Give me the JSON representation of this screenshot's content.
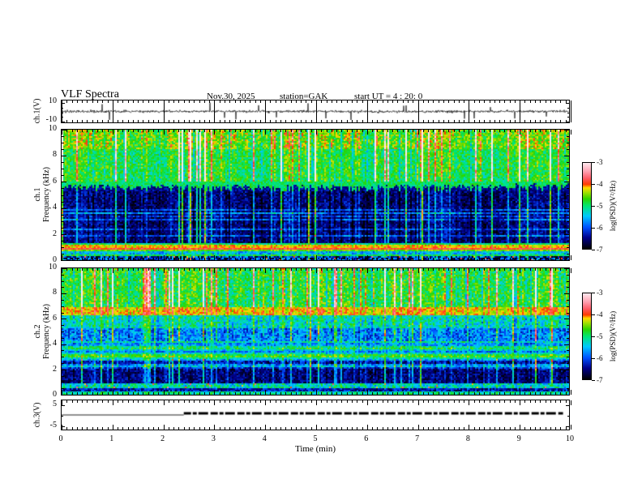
{
  "header": {
    "title": "VLF Spectra",
    "date": "Nov.30, 2025",
    "station": "station=GAK",
    "start_ut": "start UT =  4 : 20: 0"
  },
  "axes": {
    "x": {
      "label": "Time  (min)",
      "min": 0,
      "max": 10,
      "ticks": [
        "0",
        "1",
        "2",
        "3",
        "4",
        "5",
        "6",
        "7",
        "8",
        "9",
        "10"
      ],
      "minor_step_min": 0.1
    },
    "freq_ticks": [
      "10",
      "8",
      "6",
      "4",
      "2",
      "0"
    ],
    "wave_ticks": [
      "10",
      "-10"
    ],
    "ch3_ticks": [
      "5",
      "-5"
    ]
  },
  "panels": {
    "ch1_wave": {
      "ylabel": "ch.1(V)"
    },
    "ch1_spec": {
      "ylabel_line1": "ch.1",
      "ylabel_line2": "Frequency  (kHz)"
    },
    "ch2_spec": {
      "ylabel_line1": "ch.2",
      "ylabel_line2": "Frequency  (kHz)"
    },
    "ch3": {
      "ylabel": "ch.3(V)"
    }
  },
  "colorbar": {
    "label": "log(PSD)(V²/Hz)",
    "tick_labels": [
      "-3",
      "-4",
      "-5",
      "-6",
      "-7"
    ],
    "min": -7,
    "max": -3,
    "stops": [
      [
        0,
        "#000000"
      ],
      [
        0.13,
        "#00008c"
      ],
      [
        0.25,
        "#0050ff"
      ],
      [
        0.38,
        "#00c8ff"
      ],
      [
        0.5,
        "#00e673"
      ],
      [
        0.58,
        "#2bd500"
      ],
      [
        0.66,
        "#aae000"
      ],
      [
        0.71,
        "#ffd800"
      ],
      [
        0.75,
        "#ff3c00"
      ],
      [
        0.82,
        "#ff5a66"
      ],
      [
        0.9,
        "#ff9fb0"
      ],
      [
        1,
        "#ffe9ef"
      ]
    ]
  },
  "chart_data": [
    {
      "type": "line",
      "name": "ch.1 voltage waveform",
      "ylabel": "ch.1(V)",
      "xlim": [
        0,
        10
      ],
      "ylim": [
        -10,
        10
      ],
      "baseline_V": 0,
      "noise_amplitude_V": 2,
      "spike_amplitude_V": 10,
      "approx_spike_count": 30,
      "description": "continuous broadband noise around 0 V with impulsive sferic spikes reaching +/-10 V"
    },
    {
      "type": "heatmap",
      "name": "ch.1 spectrogram",
      "ylabel": "ch.1 Frequency (kHz)",
      "xlim": [
        0,
        10
      ],
      "ylim": [
        0,
        10
      ],
      "zlabel": "log(PSD)(V²/Hz)",
      "zlim": [
        -7,
        -3
      ],
      "bands": [
        {
          "f": [
            8.6,
            10
          ],
          "level": -4.55,
          "noise": 0.45,
          "streak": 1.3,
          "hot": true
        },
        {
          "f": [
            6.1,
            8.6
          ],
          "level": -4.85,
          "noise": 0.4,
          "streak": 1.0,
          "hot": true
        },
        {
          "f": [
            5.35,
            6.1
          ],
          "level": -5.6,
          "noise": 0.5,
          "streak": 1.2,
          "type": "edge",
          "hi": -4.95,
          "lo": -6.45
        },
        {
          "f": [
            1.42,
            5.35
          ],
          "level": -6.55,
          "noise": 0.35,
          "streak": 0.95,
          "dark": true
        },
        {
          "f": [
            1.28,
            1.42
          ],
          "level": -5.0,
          "noise": 0.3,
          "streak": 0.3
        },
        {
          "f": [
            1.05,
            1.28
          ],
          "level": -4.2,
          "noise": 0.25,
          "streak": 0.3
        },
        {
          "f": [
            0.95,
            1.05
          ],
          "level": -3.85,
          "noise": 0.15,
          "streak": 0.2
        },
        {
          "f": [
            0.78,
            0.95
          ],
          "level": -4.55,
          "noise": 0.3,
          "streak": 0.3
        },
        {
          "f": [
            0.55,
            0.78
          ],
          "level": -5.5,
          "noise": 0.5,
          "streak": 0.4
        },
        {
          "f": [
            0.38,
            0.55
          ],
          "level": -4.9,
          "noise": 0.35,
          "streak": 0.3
        },
        {
          "f": [
            0,
            0.38
          ],
          "level": -6.3,
          "noise": 0.9,
          "streak": 0.4,
          "dark": true,
          "dots": true
        }
      ],
      "description": "green/yellow with red impulsive streaks above ~6 kHz, dark blue-black 1.5-5.5 kHz with cyan vertical sferics, bright layered bands (yellow/red lines) below 1.4 kHz"
    },
    {
      "type": "heatmap",
      "name": "ch.2 spectrogram",
      "ylabel": "ch.2 Frequency (kHz)",
      "xlim": [
        0,
        10
      ],
      "ylim": [
        0,
        10
      ],
      "zlabel": "log(PSD)(V²/Hz)",
      "zlim": [
        -7,
        -3
      ],
      "bands": [
        {
          "f": [
            6.95,
            10
          ],
          "level": -4.8,
          "noise": 0.45,
          "streak": 1.1,
          "hot": true
        },
        {
          "f": [
            6.3,
            6.95
          ],
          "level": -4.2,
          "noise": 0.3,
          "streak": 0.7
        },
        {
          "f": [
            5.3,
            6.3
          ],
          "level": -5.25,
          "noise": 0.5,
          "streak": 0.9
        },
        {
          "f": [
            4.3,
            5.3
          ],
          "level": -5.8,
          "noise": 0.5,
          "streak": 0.7,
          "dark": true
        },
        {
          "f": [
            3.45,
            4.3
          ],
          "level": -5.35,
          "noise": 0.45,
          "streak": 0.5,
          "stripeAmp": 0.45,
          "stripePeriod": 0.6
        },
        {
          "f": [
            2.9,
            3.45
          ],
          "level": -5.0,
          "noise": 0.4,
          "streak": 0.4,
          "stripeAmp": 0.4,
          "stripePeriod": 0.5
        },
        {
          "f": [
            1.95,
            2.9
          ],
          "level": -6.0,
          "noise": 0.45,
          "streak": 0.7,
          "dark": true,
          "stripeAmp": 0.5,
          "stripePeriod": 0.55
        },
        {
          "f": [
            0.9,
            1.95
          ],
          "level": -6.55,
          "noise": 0.35,
          "streak": 0.6,
          "dark": true
        },
        {
          "f": [
            0.55,
            0.9
          ],
          "level": -5.3,
          "noise": 0.55,
          "streak": 0.4,
          "dots": true
        },
        {
          "f": [
            0.35,
            0.55
          ],
          "level": -6.35,
          "noise": 0.45,
          "streak": 0.3
        },
        {
          "f": [
            0.12,
            0.35
          ],
          "level": -5.15,
          "noise": 0.4,
          "streak": 0.3
        },
        {
          "f": [
            0,
            0.12
          ],
          "level": -6.9,
          "noise": 0.2,
          "streak": 0.1
        }
      ],
      "description": "green with red streaks above 7 kHz, bright yellow band 6.3-6.9 kHz, alternating cyan/blue/green horizontal bands 2-6 kHz, dark blue 1-2 kHz, speckled green band near 0.7 kHz"
    },
    {
      "type": "line",
      "name": "ch.3 status trace",
      "ylabel": "ch.3(V)",
      "xlim": [
        0,
        10
      ],
      "ylim": [
        -7,
        7
      ],
      "segments": [
        {
          "x": [
            0,
            2.4
          ],
          "y": 0,
          "style": "thin solid"
        },
        {
          "x": [
            2.4,
            9.85
          ],
          "y": 0.8,
          "style": "thick dashed"
        }
      ]
    }
  ]
}
